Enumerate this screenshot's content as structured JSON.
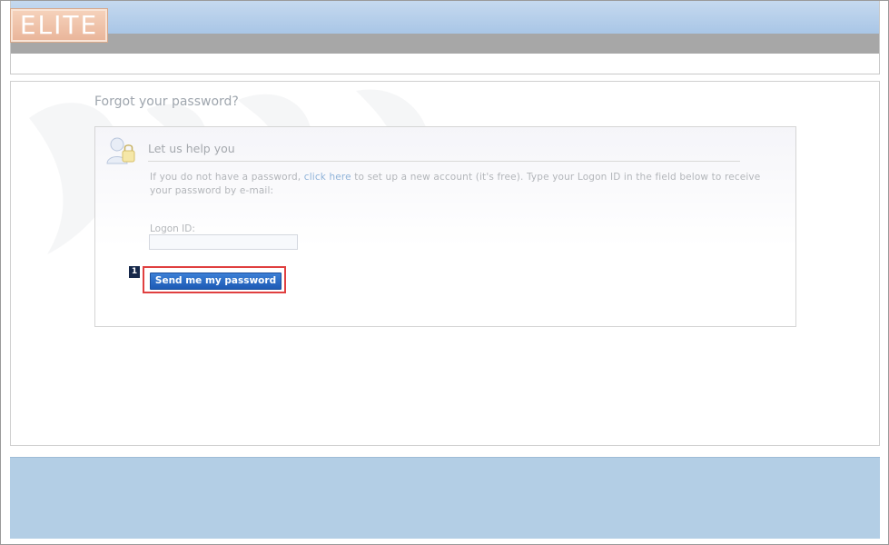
{
  "header": {
    "logo_text": "ELITE"
  },
  "main": {
    "page_title": "Forgot your password?",
    "panel": {
      "heading": "Let us help you",
      "help_text_before": "If you do not have a password, ",
      "help_link": "click here",
      "help_text_after": " to set up a new account (it's free). Type your Logon ID in the field below to receive your password by e-mail:",
      "logon_label": "Logon ID:",
      "logon_value": "",
      "logon_placeholder": ""
    },
    "send_button_label": "Send me my password",
    "annotation_badge": "1"
  },
  "colors": {
    "header_band": "#b8d0ea",
    "header_gray": "#a7a7a7",
    "footer": "#b3cee5",
    "button": "#2a6cc8",
    "highlight": "#e04040",
    "link": "#8fb3d9"
  },
  "icons": {
    "user_lock": "user-lock-icon"
  }
}
